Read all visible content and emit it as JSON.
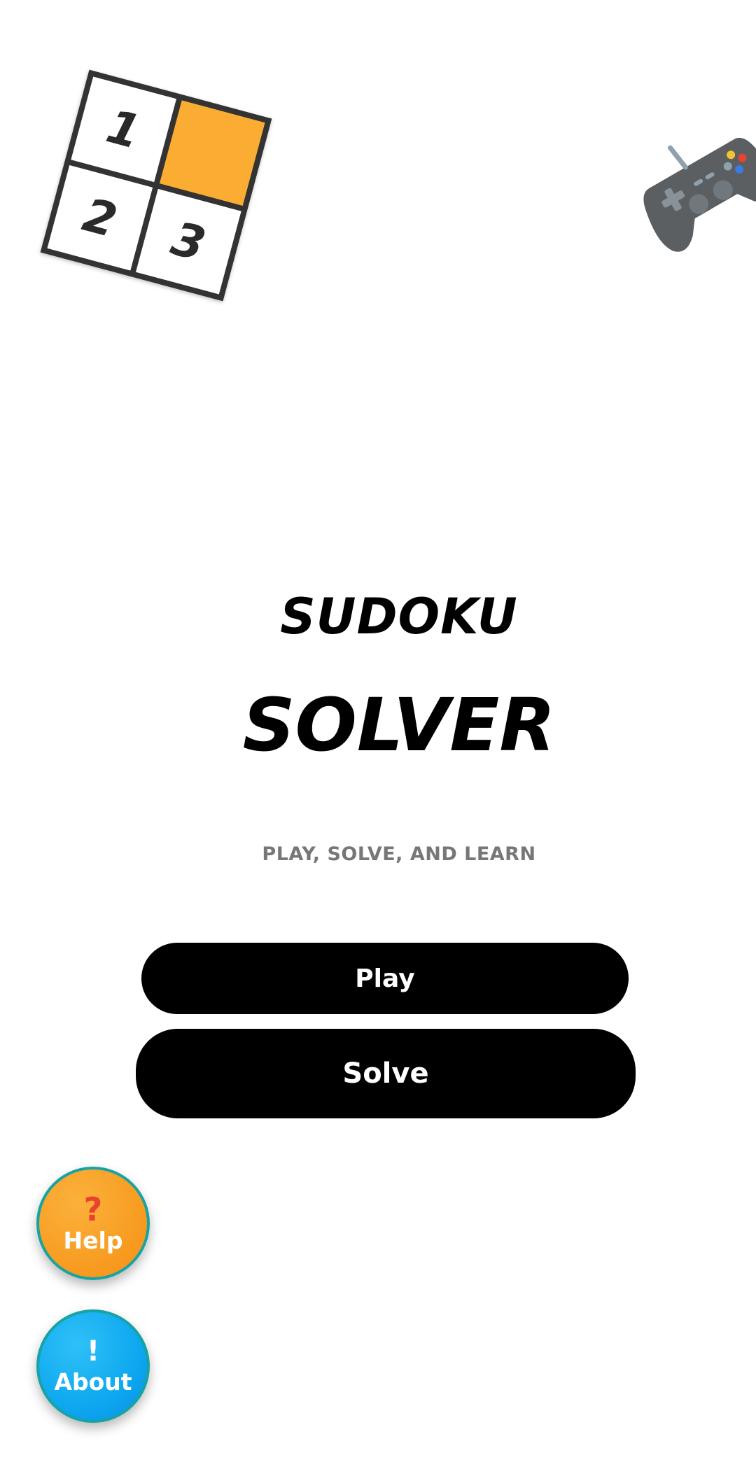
{
  "app": {
    "logo_cells": [
      "1",
      "",
      "2",
      "3"
    ],
    "title_line1": "SUDOKU",
    "title_line2": "SOLVER",
    "tagline": "PLAY, SOLVE, AND LEARN"
  },
  "buttons": {
    "play_label": "Play",
    "solve_label": "Solve"
  },
  "fabs": {
    "help": {
      "glyph": "?",
      "label": "Help"
    },
    "about": {
      "glyph": "!",
      "label": "About"
    }
  },
  "icons": {
    "logo": "sudoku-grid-icon",
    "gamepad": "gamepad-icon",
    "help": "question-mark-icon",
    "about": "exclamation-mark-icon"
  },
  "colors": {
    "background": "#ffffff",
    "button": "#000000",
    "accent_orange": "#fbad33",
    "help_fab": "#f79a1f",
    "about_fab": "#0ea8f0",
    "fab_border": "#17a3a3",
    "tagline": "#777777"
  }
}
